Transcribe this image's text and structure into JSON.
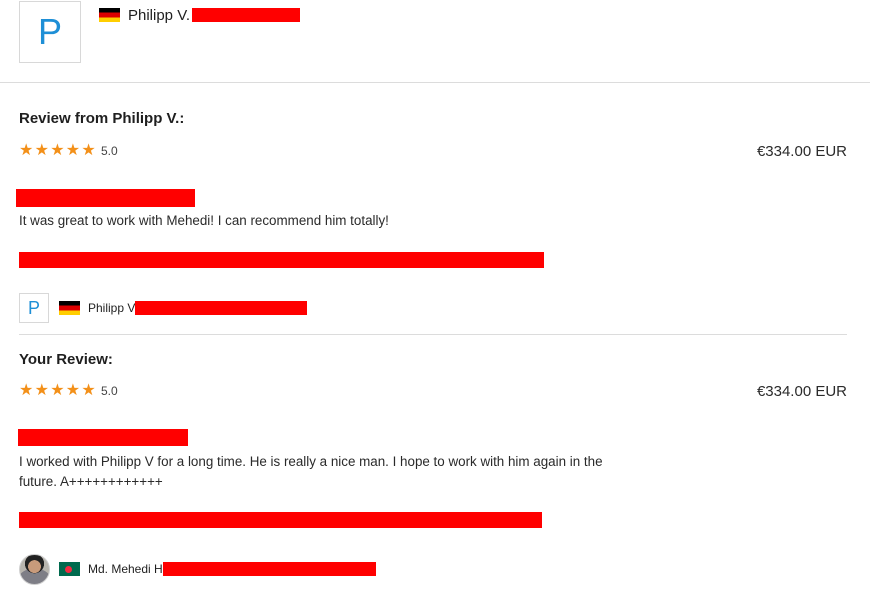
{
  "header": {
    "avatar_letter": "P",
    "flag_icon": "germany-flag-icon",
    "name": "Philipp V."
  },
  "client_review": {
    "title": "Review from Philipp V.:",
    "stars": 5,
    "rating": "5.0",
    "price": "€334.00 EUR",
    "text": "It was great to work with Mehedi! I can recommend him totally!",
    "reviewer": {
      "avatar_letter": "P",
      "flag_icon": "germany-flag-icon",
      "name": "Philipp V"
    }
  },
  "your_review": {
    "title": "Your Review:",
    "stars": 5,
    "rating": "5.0",
    "price": "€334.00 EUR",
    "text_line1": "I worked with Philipp V for a long time. He is really a nice man. I hope to work with him again in the",
    "text_line2": "future. A++++++++++++",
    "reviewer": {
      "flag_icon": "bangladesh-flag-icon",
      "name": "Md. Mehedi H"
    }
  },
  "colors": {
    "star": "#f39019",
    "avatar_letter": "#1e8fd6",
    "redaction": "#ff0000"
  }
}
